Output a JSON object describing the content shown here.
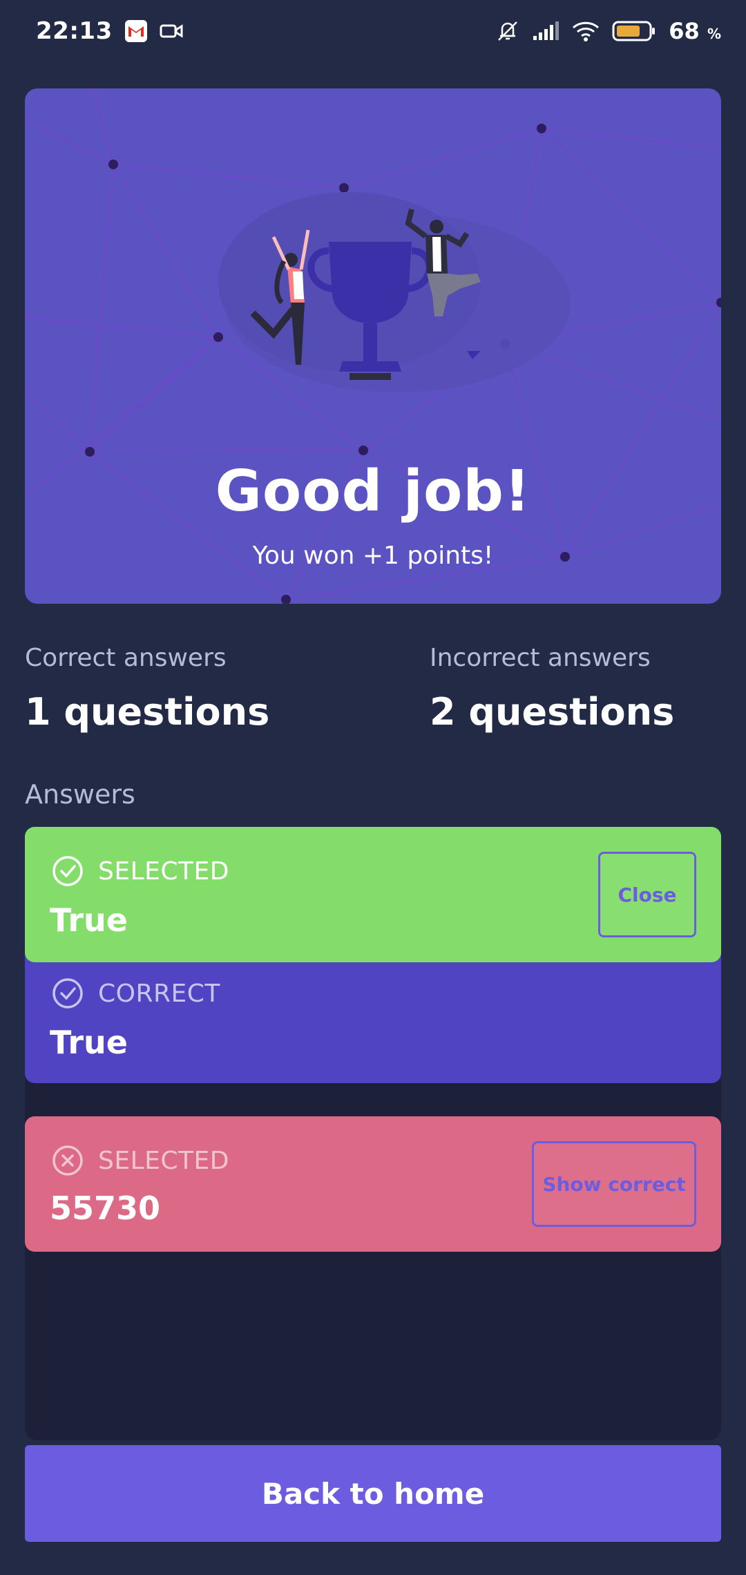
{
  "status_bar": {
    "time": "22:13",
    "battery_percent": "68",
    "battery_unit": "%",
    "icons": [
      "gmail-icon",
      "video-camera-icon",
      "mute-icon",
      "cell-signal-icon",
      "wifi-icon",
      "battery-icon"
    ]
  },
  "hero": {
    "title": "Good job!",
    "subtitle": "You won +1 points!",
    "illustration": "trophy-celebration-illustration"
  },
  "stats": {
    "correct_label": "Correct answers",
    "correct_value": "1 questions",
    "incorrect_label": "Incorrect answers",
    "incorrect_value": "2 questions"
  },
  "answers": {
    "heading": "Answers",
    "items": [
      {
        "tag": "SELECTED",
        "value": "True",
        "status": "correct",
        "button": "Close",
        "color": "#84dd6b"
      },
      {
        "tag": "CORRECT",
        "value": "True",
        "status": "reference",
        "color": "#5044c3"
      },
      {
        "tag": "SELECTED",
        "value": "55730",
        "status": "incorrect",
        "button": "Show correct",
        "color": "#dc6a86"
      }
    ]
  },
  "footer": {
    "back_home_label": "Back to home"
  },
  "colors": {
    "background": "#232a45",
    "hero": "#5b53c2",
    "accent": "#6b5ce0",
    "correct": "#84dd6b",
    "incorrect": "#dc6a86"
  }
}
